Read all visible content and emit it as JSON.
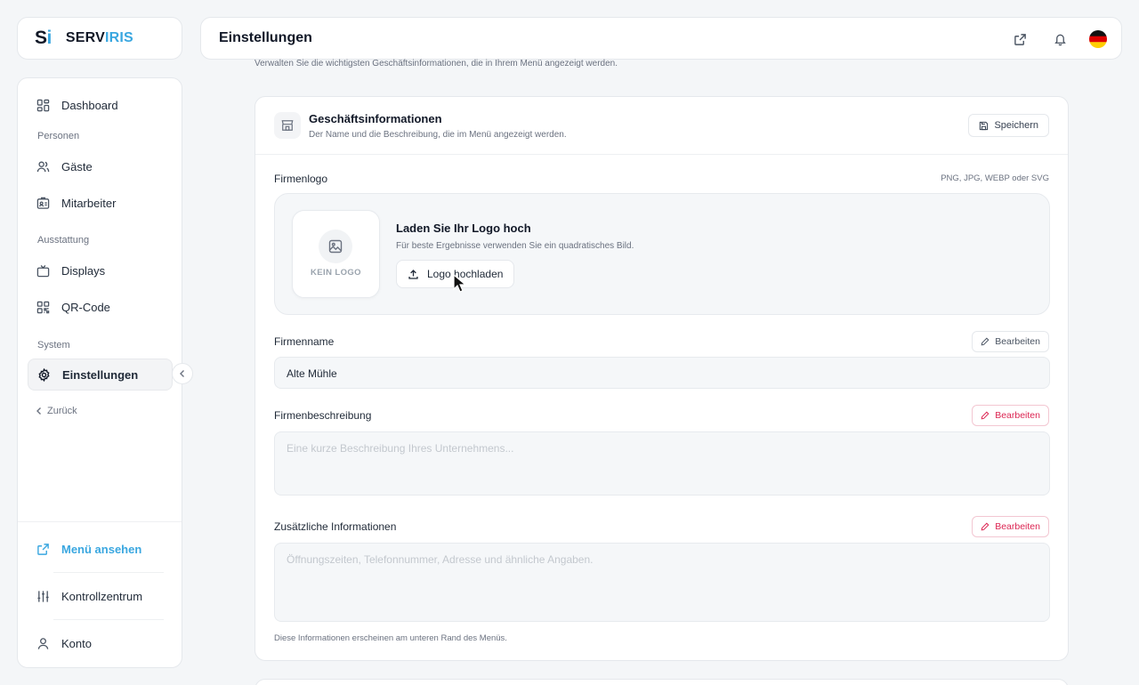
{
  "brand": {
    "mark": "S",
    "mark_accent": "i",
    "name": "SERV",
    "name_accent": "IRIS"
  },
  "sidebar": {
    "items": [
      {
        "label": "Dashboard",
        "icon": "dashboard-icon"
      },
      {
        "section": "Personen"
      },
      {
        "label": "Gäste",
        "icon": "users-icon"
      },
      {
        "label": "Mitarbeiter",
        "icon": "id-card-icon"
      },
      {
        "section": "Ausstattung"
      },
      {
        "label": "Displays",
        "icon": "tv-icon"
      },
      {
        "label": "QR-Code",
        "icon": "qr-code-icon"
      },
      {
        "section": "System"
      },
      {
        "label": "Einstellungen",
        "icon": "gear-icon",
        "active": true
      }
    ],
    "back_label": "Zurück",
    "bottom": [
      {
        "label": "Menü ansehen",
        "icon": "external-link-icon"
      },
      {
        "label": "Kontrollzentrum",
        "icon": "sliders-icon"
      },
      {
        "label": "Konto",
        "icon": "user-icon"
      }
    ]
  },
  "header": {
    "title": "Einstellungen",
    "language_flag": "de-flag-icon"
  },
  "page": {
    "subtitle": "Verwalten Sie die wichtigsten Geschäftsinformationen, die in Ihrem Menü angezeigt werden."
  },
  "card": {
    "title": "Geschäftsinformationen",
    "description": "Der Name und die Beschreibung, die im Menü angezeigt werden.",
    "save_label": "Speichern",
    "logo": {
      "label": "Firmenlogo",
      "formats": "PNG, JPG, WEBP oder SVG",
      "placeholder": "KEIN LOGO",
      "upload_title": "Laden Sie Ihr Logo hoch",
      "upload_desc": "Für beste Ergebnisse verwenden Sie ein quadratisches Bild.",
      "upload_button": "Logo hochladen"
    },
    "name": {
      "label": "Firmenname",
      "value": "Alte Mühle",
      "edit_label": "Bearbeiten"
    },
    "description_field": {
      "label": "Firmenbeschreibung",
      "placeholder": "Eine kurze Beschreibung Ihres Unternehmens...",
      "edit_label": "Bearbeiten"
    },
    "additional": {
      "label": "Zusätzliche Informationen",
      "placeholder": "Öffnungszeiten, Telefonnummer, Adresse und ähnliche Angaben.",
      "edit_label": "Bearbeiten",
      "footnote": "Diese Informationen erscheinen am unteren Rand des Menüs."
    }
  },
  "colors": {
    "accent": "#3aa7e0",
    "danger": "#dc2653",
    "background": "#f4f6f8"
  }
}
